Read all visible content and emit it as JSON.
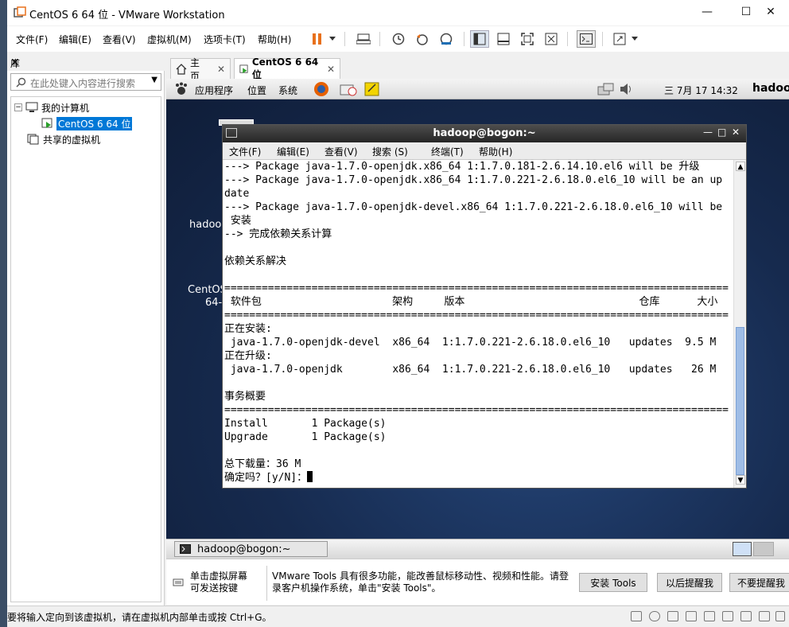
{
  "window": {
    "title": "CentOS 6 64 位 - VMware Workstation",
    "controls": [
      "—",
      "☐",
      "✕"
    ]
  },
  "menu": {
    "items": [
      "文件(F)",
      "编辑(E)",
      "查看(V)",
      "虚拟机(M)",
      "选项卡(T)",
      "帮助(H)"
    ]
  },
  "library": {
    "title": "库",
    "close": "✕",
    "search_placeholder": "在此处键入内容进行搜索",
    "tree": {
      "my_computer": "我的计算机",
      "vm_selected": "CentOS 6 64 位",
      "shared": "共享的虚拟机"
    }
  },
  "tabs": [
    {
      "label": "主页",
      "close": "✕"
    },
    {
      "label": "CentOS 6 64 位",
      "close": "✕"
    }
  ],
  "guest": {
    "panel": {
      "applications": "应用程序",
      "places": "位置",
      "system": "系统",
      "clock": "三 7月 17 14:32",
      "user": "hadoo"
    },
    "desktop_labels": [
      "hadoo",
      "CentOS",
      "64-"
    ],
    "terminal": {
      "title": "hadoop@bogon:~",
      "menu": [
        "文件(F)",
        "编辑(E)",
        "查看(V)",
        "搜索 (S)",
        "终端(T)",
        "帮助(H)"
      ],
      "lines": [
        "---> Package java-1.7.0-openjdk.x86_64 1:1.7.0.181-2.6.14.10.el6 will be 升级",
        "---> Package java-1.7.0-openjdk.x86_64 1:1.7.0.221-2.6.18.0.el6_10 will be an up",
        "date",
        "---> Package java-1.7.0-openjdk-devel.x86_64 1:1.7.0.221-2.6.18.0.el6_10 will be",
        " 安装",
        "--> 完成依赖关系计算",
        "",
        "依赖关系解决",
        "",
        "=================================================================================",
        " 软件包                     架构     版本                            仓库      大小",
        "=================================================================================",
        "正在安装:",
        " java-1.7.0-openjdk-devel  x86_64  1:1.7.0.221-2.6.18.0.el6_10   updates  9.5 M",
        "正在升级:",
        " java-1.7.0-openjdk        x86_64  1:1.7.0.221-2.6.18.0.el6_10   updates   26 M",
        "",
        "事务概要",
        "=================================================================================",
        "Install       1 Package(s)",
        "Upgrade       1 Package(s)",
        "",
        "总下载量：36 M"
      ],
      "prompt": "确定吗？[y/N]："
    },
    "taskbar_item": "hadoop@bogon:~"
  },
  "notification": {
    "hint": "单击虚拟屏幕\n可发送按键",
    "message": "VMware Tools 具有很多功能，能改善鼠标移动性、视频和性能。请登录客户机操作系统，单击\"安装 Tools\"。",
    "install_button": "安装 Tools",
    "remind_button": "以后提醒我",
    "never_button": "不要提醒我"
  },
  "statusbar": {
    "text": "要将输入定向到该虚拟机，请在虚拟机内部单击或按 Ctrl+G。"
  },
  "colors": {
    "accent": "#0078d7",
    "pause": "#e8711c",
    "terminal_title": "#2d2d2d",
    "desktop": "#1b2a4a"
  }
}
